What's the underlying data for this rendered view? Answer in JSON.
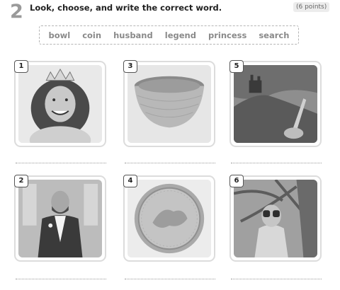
{
  "exercise": {
    "number": "2",
    "instruction": "Look, choose, and write the correct word.",
    "points": "(6 points)"
  },
  "word_bank": [
    "bowl",
    "coin",
    "husband",
    "legend",
    "princess",
    "search"
  ],
  "items": [
    {
      "number": "1",
      "picture": "girl-with-crown"
    },
    {
      "number": "3",
      "picture": "bowl"
    },
    {
      "number": "5",
      "picture": "castle-on-hill"
    },
    {
      "number": "2",
      "picture": "man-in-suit"
    },
    {
      "number": "4",
      "picture": "silver-coin"
    },
    {
      "number": "6",
      "picture": "girl-with-binoculars"
    }
  ],
  "colors": {
    "exercise_number": "#9a9a9a",
    "card_border": "#dcdcdc",
    "dotted_line": "#9a9a9a"
  }
}
